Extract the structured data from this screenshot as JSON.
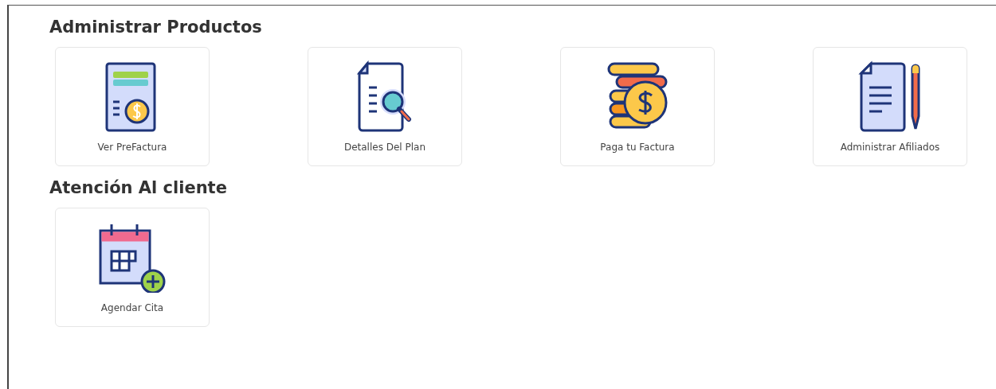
{
  "sections": [
    {
      "title": "Administrar Productos",
      "tiles": [
        {
          "label": "Ver PreFactura",
          "kind": "invoice"
        },
        {
          "label": "Detalles Del Plan",
          "kind": "search-doc"
        },
        {
          "label": "Paga tu Factura",
          "kind": "coins"
        },
        {
          "label": "Administrar Afiliados",
          "kind": "doc-pencil"
        }
      ]
    },
    {
      "title": "Atención Al cliente",
      "tiles": [
        {
          "label": "Agendar Cita",
          "kind": "calendar-add"
        }
      ]
    }
  ]
}
